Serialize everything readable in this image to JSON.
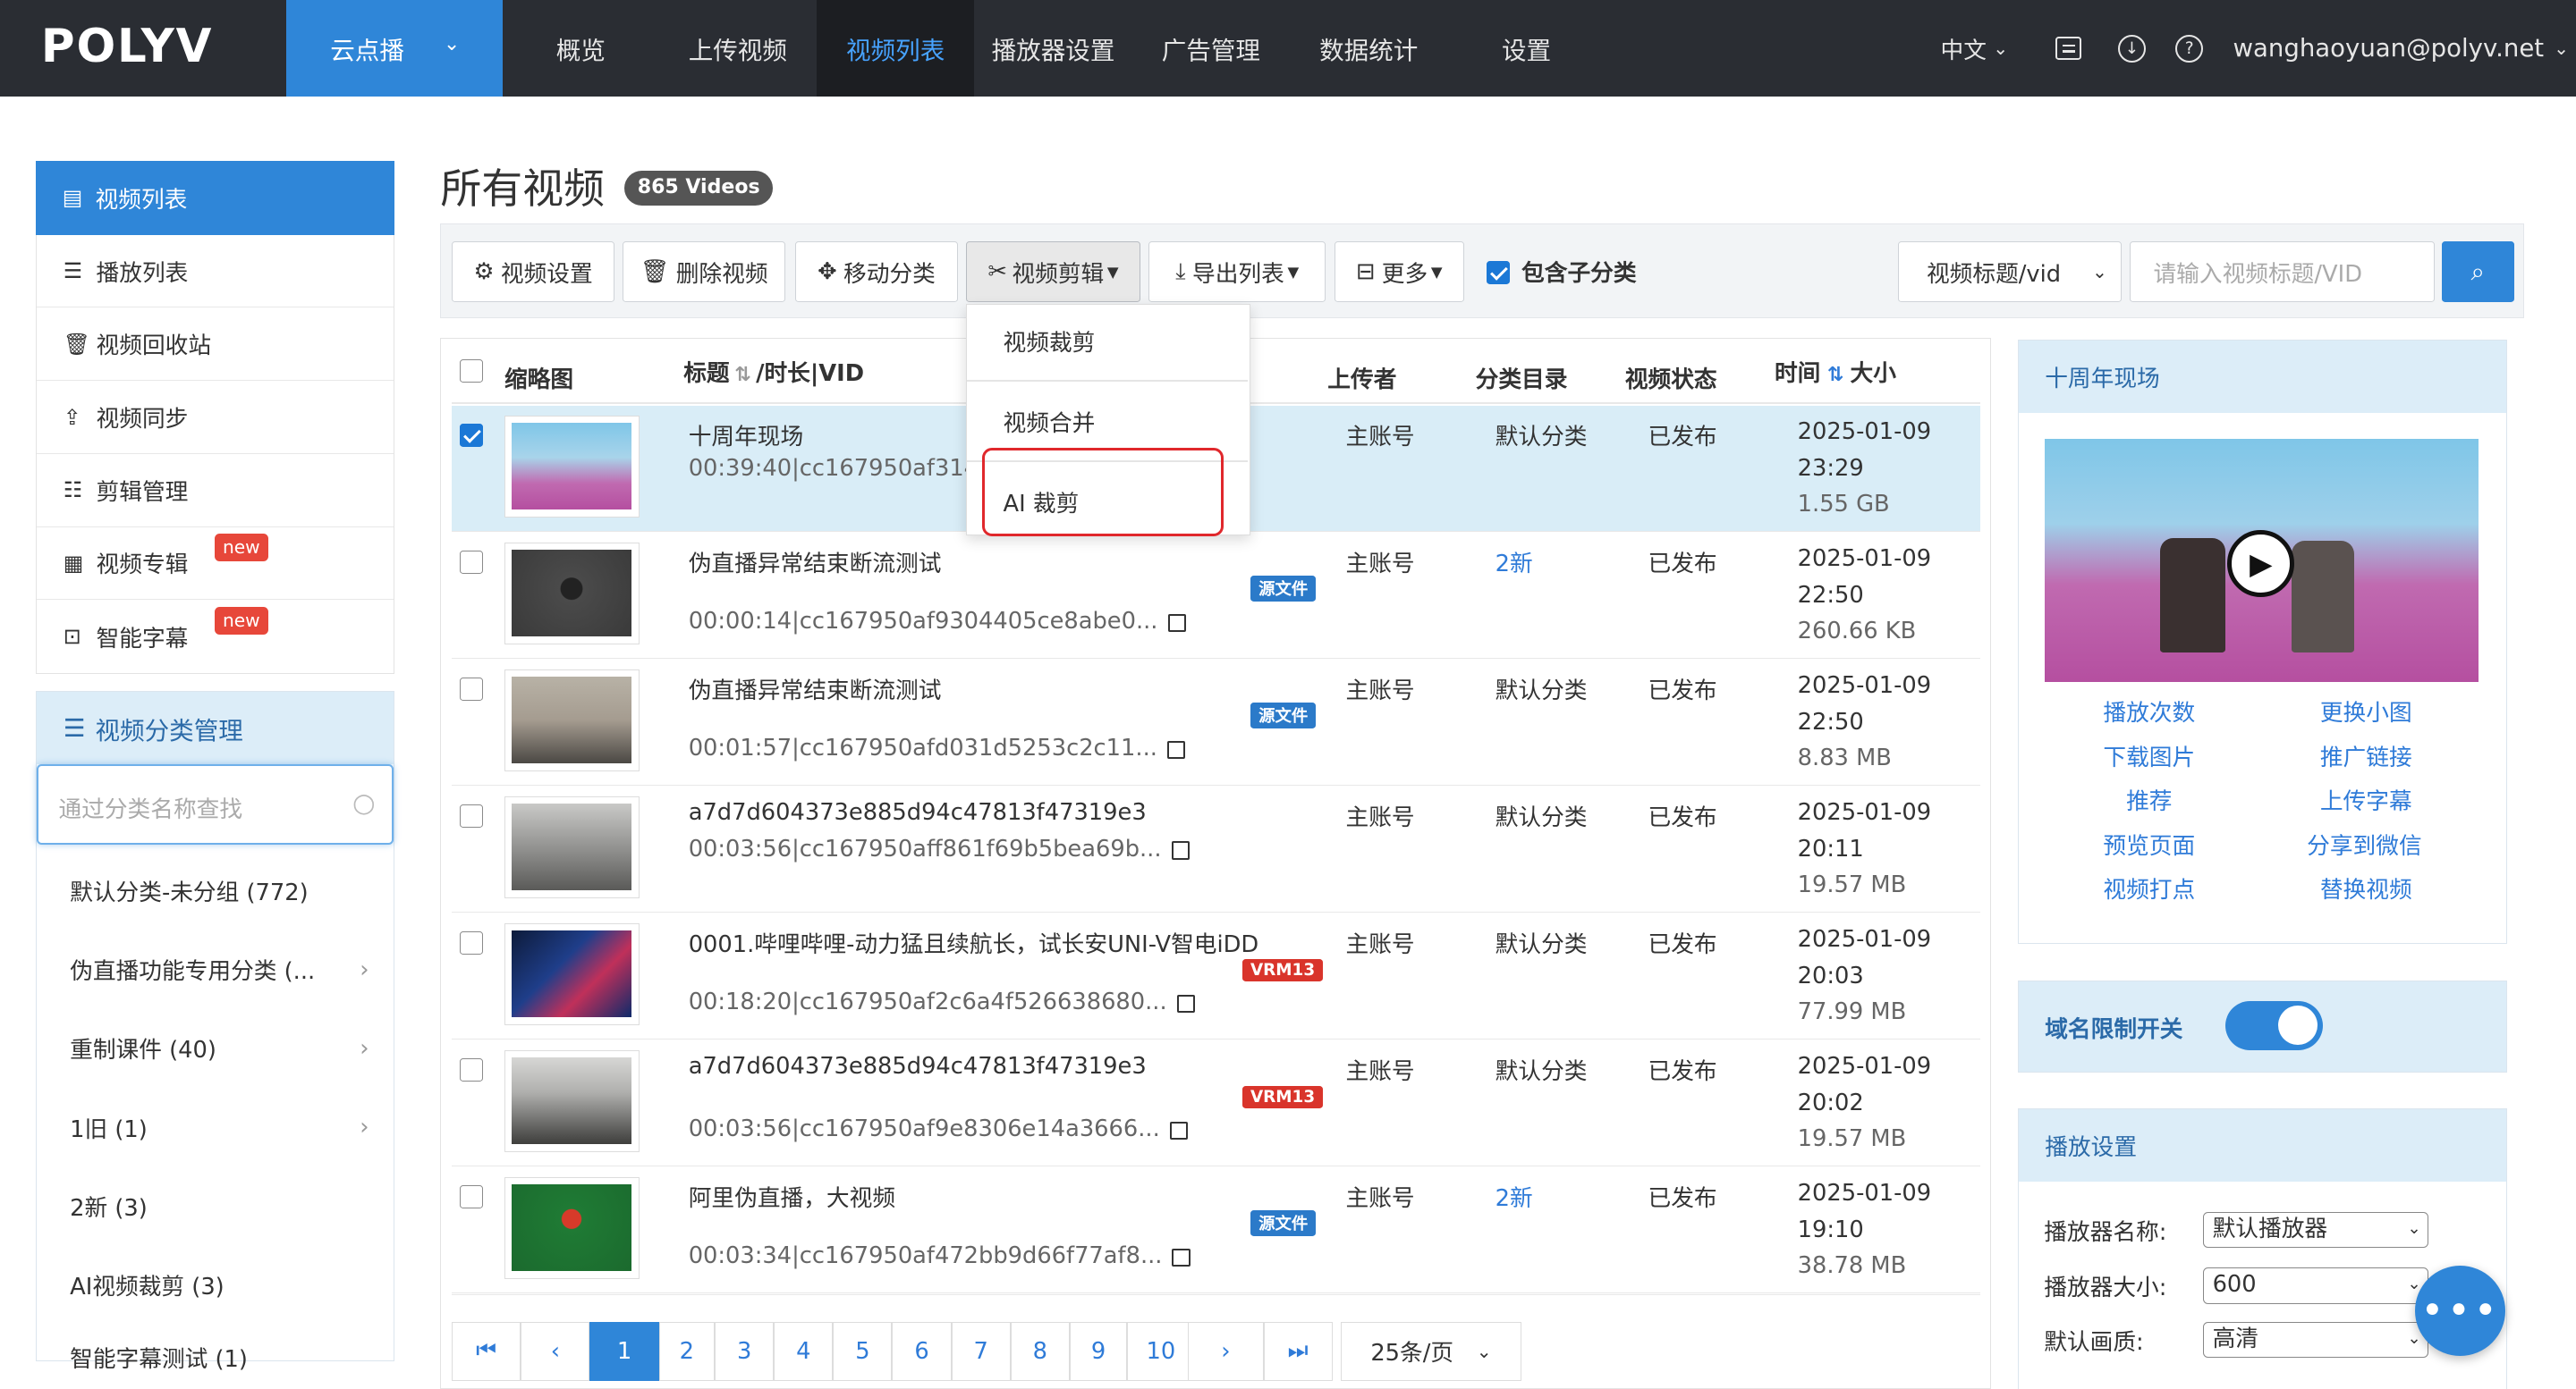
{
  "app": {
    "logo": "POLYV",
    "product": "云点播",
    "lang": "中文",
    "user": "wanghaoyuan@polyv.net"
  },
  "nav": [
    "概览",
    "上传视频",
    "视频列表",
    "播放器设置",
    "广告管理",
    "数据统计",
    "设置"
  ],
  "sidebar": {
    "items": [
      {
        "label": "视频列表",
        "icon": "film-icon",
        "active": true
      },
      {
        "label": "播放列表",
        "icon": "list-icon"
      },
      {
        "label": "视频回收站",
        "icon": "trash-icon"
      },
      {
        "label": "视频同步",
        "icon": "sync-icon"
      },
      {
        "label": "剪辑管理",
        "icon": "edit-list-icon"
      },
      {
        "label": "视频专辑",
        "icon": "grid-icon",
        "badge": "new"
      },
      {
        "label": "智能字幕",
        "icon": "subtitle-icon",
        "badge": "new"
      }
    ],
    "cat_title": "视频分类管理",
    "cat_search_placeholder": "通过分类名称查找",
    "categories": [
      "默认分类-未分组 (772)",
      "伪直播功能专用分类 (...",
      "重制课件 (40)",
      "1旧 (1)",
      "2新 (3)",
      "AI视频裁剪 (3)",
      "智能字幕测试 (1)"
    ]
  },
  "page": {
    "title": "所有视频",
    "count": "865 Videos"
  },
  "toolbar": {
    "settings": "视频设置",
    "delete": "删除视频",
    "move": "移动分类",
    "clip": "视频剪辑",
    "export": "导出列表",
    "more": "更多",
    "include_sub": "包含子分类",
    "search_type": "视频标题/vid",
    "search_placeholder": "请输入视频标题/VID"
  },
  "clip_menu": [
    "视频裁剪",
    "视频合并",
    "AI 裁剪"
  ],
  "table": {
    "headers": {
      "thumb": "缩略图",
      "title": "标题",
      "duration": "/时长|VID",
      "uploader": "上传者",
      "category": "分类目录",
      "status": "视频状态",
      "time": "时间",
      "size": "大小"
    },
    "rows": [
      {
        "title": "十周年现场",
        "meta": "00:39:40|cc167950af314",
        "uploader": "主账号",
        "category": "默认分类",
        "status": "已发布",
        "date": "2025-01-09",
        "time": "23:29",
        "size": "1.55 GB",
        "checked": true,
        "tag": "",
        "tag_color": "#2f7bd8"
      },
      {
        "title": "伪直播异常结束断流测试",
        "meta": "00:00:14|cc167950af9304405ce8abe0...",
        "uploader": "主账号",
        "category": "2新",
        "status": "已发布",
        "date": "2025-01-09",
        "time": "22:50",
        "size": "260.66 KB",
        "checked": false,
        "tag": "源文件",
        "tag_color": "#2b7ac9"
      },
      {
        "title": "伪直播异常结束断流测试",
        "meta": "00:01:57|cc167950afd031d5253c2c11...",
        "uploader": "主账号",
        "category": "默认分类",
        "status": "已发布",
        "date": "2025-01-09",
        "time": "22:50",
        "size": "8.83 MB",
        "checked": false,
        "tag": "源文件",
        "tag_color": "#2b7ac9"
      },
      {
        "title": "a7d7d604373e885d94c47813f47319e3",
        "meta": "00:03:56|cc167950aff861f69b5bea69b...",
        "uploader": "主账号",
        "category": "默认分类",
        "status": "已发布",
        "date": "2025-01-09",
        "time": "20:11",
        "size": "19.57 MB",
        "checked": false,
        "tag": "",
        "tag_color": "#2b7ac9"
      },
      {
        "title": "0001.哔哩哔哩-动力猛且续航长，试长安UNI-V智电iDD",
        "meta": "00:18:20|cc167950af2c6a4f526638680...",
        "uploader": "主账号",
        "category": "默认分类",
        "status": "已发布",
        "date": "2025-01-09",
        "time": "20:03",
        "size": "77.99 MB",
        "checked": false,
        "tag": "VRM13",
        "tag_color": "#d9342b"
      },
      {
        "title": "a7d7d604373e885d94c47813f47319e3",
        "meta": "00:03:56|cc167950af9e8306e14a3666...",
        "uploader": "主账号",
        "category": "默认分类",
        "status": "已发布",
        "date": "2025-01-09",
        "time": "20:02",
        "size": "19.57 MB",
        "checked": false,
        "tag": "VRM13",
        "tag_color": "#d9342b"
      },
      {
        "title": "阿里伪直播，大视频",
        "meta": "00:03:34|cc167950af472bb9d66f77af8...",
        "uploader": "主账号",
        "category": "2新",
        "status": "已发布",
        "date": "2025-01-09",
        "time": "19:10",
        "size": "38.78 MB",
        "checked": false,
        "tag": "源文件",
        "tag_color": "#2b7ac9"
      }
    ]
  },
  "pagination": {
    "pages": [
      "1",
      "2",
      "3",
      "4",
      "5",
      "6",
      "7",
      "8",
      "9",
      "10"
    ],
    "current": "1",
    "per_page": "25条/页"
  },
  "preview": {
    "title": "十周年现场",
    "links": [
      "播放次数",
      "更换小图",
      "下载图片",
      "推广链接",
      "推荐",
      "上传字幕",
      "预览页面",
      "分享到微信",
      "视频打点",
      "替换视频"
    ]
  },
  "domain": {
    "label": "域名限制开关",
    "on": true
  },
  "player": {
    "title": "播放设置",
    "name_label": "播放器名称:",
    "name_value": "默认播放器",
    "size_label": "播放器大小:",
    "size_value": "600",
    "quality_label": "默认画质:",
    "quality_value": "高清"
  }
}
